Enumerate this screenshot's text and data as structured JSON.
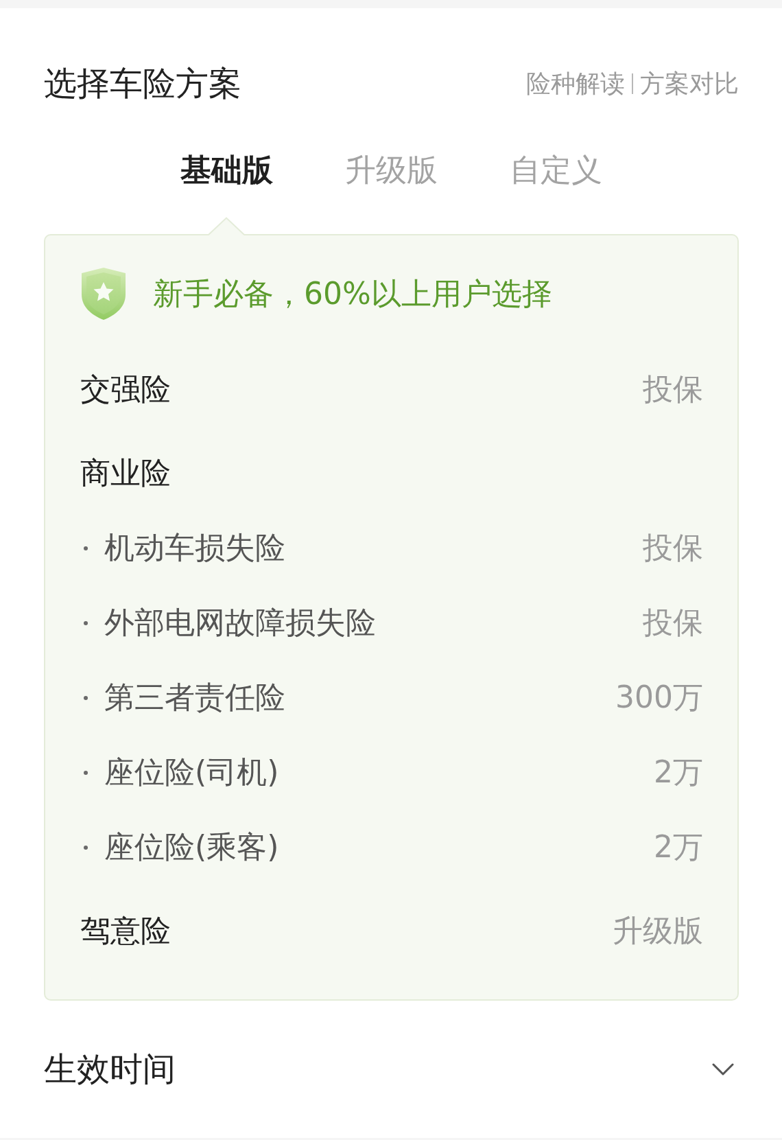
{
  "header": {
    "title": "选择车险方案",
    "links": [
      "险种解读",
      "方案对比"
    ]
  },
  "tabs": [
    {
      "label": "基础版",
      "selected": true
    },
    {
      "label": "升级版",
      "selected": false
    },
    {
      "label": "自定义",
      "selected": false
    }
  ],
  "plan": {
    "badge": "新手必备，60%以上用户选择",
    "rows": [
      {
        "label": "交强险",
        "value": "投保"
      },
      {
        "label": "商业险",
        "children": [
          {
            "label": "机动车损失险",
            "value": "投保"
          },
          {
            "label": "外部电网故障损失险",
            "value": "投保"
          },
          {
            "label": "第三者责任险",
            "value": "300万"
          },
          {
            "label": "座位险(司机)",
            "value": "2万"
          },
          {
            "label": "座位险(乘客)",
            "value": "2万"
          }
        ]
      },
      {
        "label": "驾意险",
        "value": "升级版"
      }
    ]
  },
  "effective_time": {
    "label": "生效时间"
  }
}
